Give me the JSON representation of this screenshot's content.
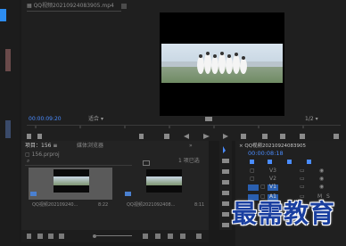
{
  "program_monitor": {
    "tab_title": "QQ视频20210924083905.mp4",
    "timecode": "00:00:09:20",
    "fit_label": "适合",
    "page_fraction": "1/2",
    "end_timecode": "00:00:0"
  },
  "project_panel": {
    "tab_title": "项目：156",
    "tab_media_browser": "媒体浏览器",
    "project_file": "156.prproj",
    "selected_count": "1 项已选",
    "clips": [
      {
        "name": "QQ视频202109240...",
        "duration": "8:22"
      },
      {
        "name": "QQ视频2021092408...",
        "duration": "8:11"
      }
    ]
  },
  "timeline": {
    "tab_title": "QQ视频20210924083905",
    "timecode": "00:00:08:18",
    "tracks": [
      {
        "label": "V3"
      },
      {
        "label": "V2"
      },
      {
        "label": "V1"
      },
      {
        "label": "A1"
      },
      {
        "label": "A2"
      },
      {
        "label": "A3"
      }
    ]
  },
  "watermark": {
    "text": "最需教育"
  },
  "colors": {
    "accent_blue": "#2d8cf0",
    "timecode_blue": "#4a8cff",
    "panel_bg": "#222222",
    "watermark_blue": "#1a3fa0"
  }
}
